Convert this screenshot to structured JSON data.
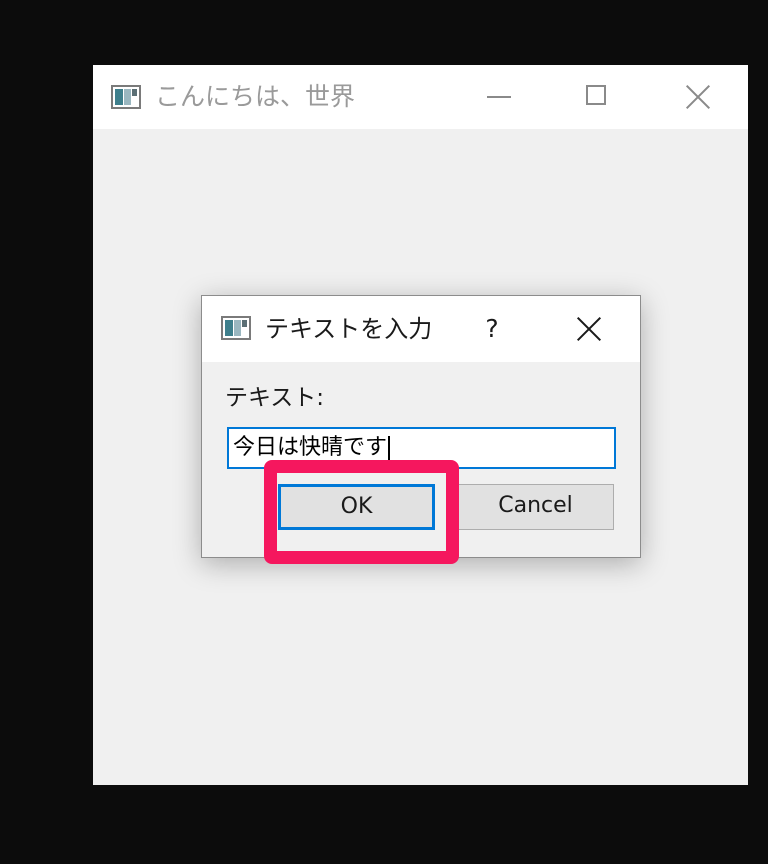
{
  "main_window": {
    "title": "こんにちは、世界",
    "icon": "app-window-icon",
    "controls": {
      "minimize_icon": "minimize-icon",
      "maximize_icon": "maximize-icon",
      "close_icon": "close-icon"
    }
  },
  "dialog": {
    "title": "テキストを入力",
    "icon": "app-window-icon",
    "help_label": "?",
    "close_icon": "close-icon",
    "field_label": "テキスト:",
    "input_value": "今日は快晴です",
    "ok_label": "OK",
    "cancel_label": "Cancel"
  },
  "annotation": {
    "highlight_color": "#f5175e",
    "target": "OK"
  },
  "colors": {
    "focus_accent": "#0078d7",
    "desktop_background": "#0c0c0c",
    "window_background": "#f0f0f0"
  }
}
